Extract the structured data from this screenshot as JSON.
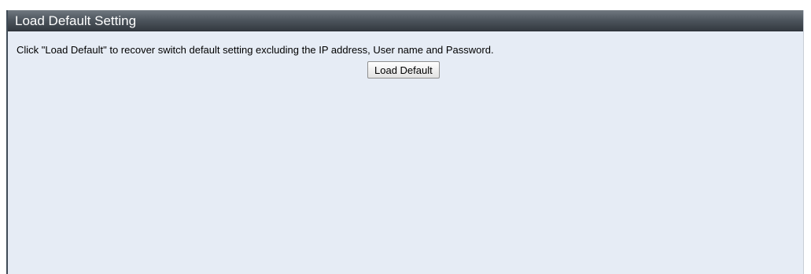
{
  "panel": {
    "title": "Load Default Setting",
    "description": "Click \"Load Default\" to recover switch default setting excluding the IP address, User name and Password.",
    "button_label": "Load Default"
  },
  "colors": {
    "titlebar": "#4c545c",
    "background": "#e6ecf5",
    "border": "#3f4b56"
  }
}
